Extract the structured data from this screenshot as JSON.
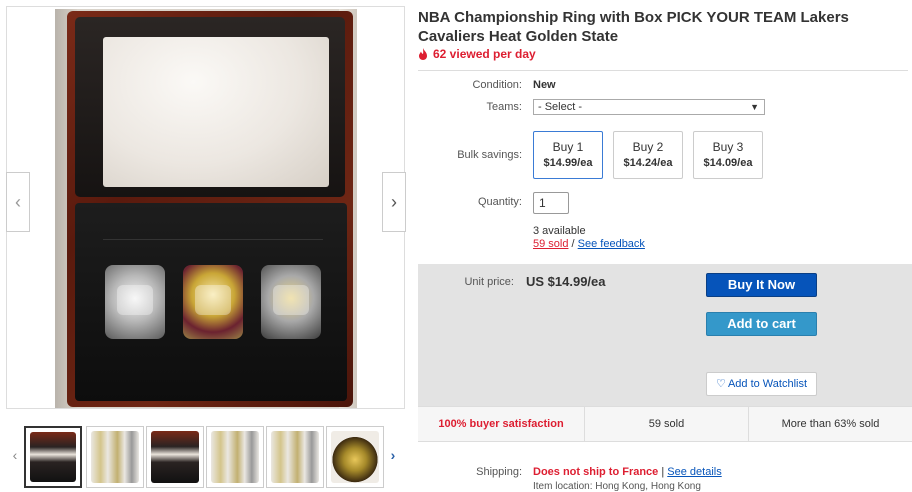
{
  "gallery": {
    "prev_arrow": "‹",
    "next_arrow": "›",
    "thumb_prev": "‹",
    "thumb_next": "›"
  },
  "title": "NBA Championship Ring with Box PICK YOUR TEAM Lakers Cavaliers Heat Golden State",
  "viewed": "62 viewed per day",
  "condition": {
    "label": "Condition:",
    "value": "New"
  },
  "teams": {
    "label": "Teams:",
    "selected": "- Select -"
  },
  "bulk": {
    "label": "Bulk savings:",
    "options": [
      {
        "label": "Buy 1",
        "price": "$14.99/ea"
      },
      {
        "label": "Buy 2",
        "price": "$14.24/ea"
      },
      {
        "label": "Buy 3",
        "price": "$14.09/ea"
      }
    ]
  },
  "quantity": {
    "label": "Quantity:",
    "value": "1"
  },
  "availability": {
    "available": "3 available",
    "sold": "59 sold",
    "separator": " / ",
    "feedback": "See feedback"
  },
  "buybox": {
    "unit_label": "Unit price:",
    "unit_price": "US $14.99/ea",
    "buy_now": "Buy It Now",
    "add_cart": "Add to cart",
    "watchlist": "Add to Watchlist"
  },
  "stats": {
    "satisfaction": "100% buyer satisfaction",
    "sold": "59 sold",
    "more_sold": "More than 63% sold"
  },
  "shipping": {
    "label": "Shipping:",
    "value": "Does not ship to France",
    "separator": " | ",
    "details": "See details",
    "location": "Item location: Hong Kong, Hong Kong"
  },
  "colors": {
    "accent_blue": "#0654ba",
    "cart_blue": "#3498ca",
    "alert_red": "#dd1e31"
  }
}
